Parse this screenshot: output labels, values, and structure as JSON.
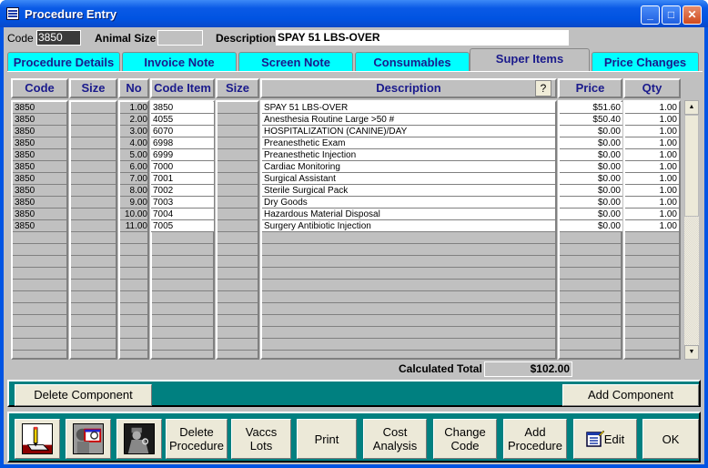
{
  "window": {
    "title": "Procedure Entry",
    "minimize": "_",
    "maximize": "□",
    "close": "✕"
  },
  "header": {
    "code_label": "Code",
    "code_value": "3850",
    "animal_size_label": "Animal Size",
    "animal_size_value": "",
    "description_label": "Description",
    "description_value": "SPAY 51 LBS-OVER"
  },
  "tabs": [
    {
      "label": "Procedure Details",
      "active": false
    },
    {
      "label": "Invoice Note",
      "active": false
    },
    {
      "label": "Screen Note",
      "active": false
    },
    {
      "label": "Consumables",
      "active": false
    },
    {
      "label": "Super Items",
      "active": true
    },
    {
      "label": "Price Changes",
      "active": false
    }
  ],
  "table": {
    "columns": [
      "Code",
      "Size",
      "No",
      "Code Item",
      "Size",
      "Description",
      "Price",
      "Qty"
    ],
    "help_button": "?",
    "rows": [
      {
        "code": "3850",
        "size": "",
        "no": "1.00",
        "code_item": "3850",
        "item_size": "",
        "description": "SPAY 51 LBS-OVER",
        "price": "$51.60",
        "qty": "1.00"
      },
      {
        "code": "3850",
        "size": "",
        "no": "2.00",
        "code_item": "4055",
        "item_size": "",
        "description": "Anesthesia Routine Large >50 #",
        "price": "$50.40",
        "qty": "1.00"
      },
      {
        "code": "3850",
        "size": "",
        "no": "3.00",
        "code_item": "6070",
        "item_size": "",
        "description": "HOSPITALIZATION (CANINE)/DAY",
        "price": "$0.00",
        "qty": "1.00"
      },
      {
        "code": "3850",
        "size": "",
        "no": "4.00",
        "code_item": "6998",
        "item_size": "",
        "description": "Preanesthetic Exam",
        "price": "$0.00",
        "qty": "1.00"
      },
      {
        "code": "3850",
        "size": "",
        "no": "5.00",
        "code_item": "6999",
        "item_size": "",
        "description": "Preanesthetic Injection",
        "price": "$0.00",
        "qty": "1.00"
      },
      {
        "code": "3850",
        "size": "",
        "no": "6.00",
        "code_item": "7000",
        "item_size": "",
        "description": "Cardiac Monitoring",
        "price": "$0.00",
        "qty": "1.00"
      },
      {
        "code": "3850",
        "size": "",
        "no": "7.00",
        "code_item": "7001",
        "item_size": "",
        "description": "Surgical Assistant",
        "price": "$0.00",
        "qty": "1.00"
      },
      {
        "code": "3850",
        "size": "",
        "no": "8.00",
        "code_item": "7002",
        "item_size": "",
        "description": "Sterile Surgical Pack",
        "price": "$0.00",
        "qty": "1.00"
      },
      {
        "code": "3850",
        "size": "",
        "no": "9.00",
        "code_item": "7003",
        "item_size": "",
        "description": "Dry Goods",
        "price": "$0.00",
        "qty": "1.00"
      },
      {
        "code": "3850",
        "size": "",
        "no": "10.00",
        "code_item": "7004",
        "item_size": "",
        "description": "Hazardous Material Disposal",
        "price": "$0.00",
        "qty": "1.00"
      },
      {
        "code": "3850",
        "size": "",
        "no": "11.00",
        "code_item": "7005",
        "item_size": "",
        "description": "Surgery Antibiotic Injection",
        "price": "$0.00",
        "qty": "1.00"
      }
    ]
  },
  "total": {
    "label": "Calculated Total",
    "value": "$102.00"
  },
  "component_bar": {
    "delete": "Delete Component",
    "add": "Add Component"
  },
  "toolbar": {
    "delete_procedure": "Delete\nProcedure",
    "vaccs_lots": "Vaccs\nLots",
    "print": "Print",
    "cost_analysis": "Cost\nAnalysis",
    "change_code": "Change\nCode",
    "add_procedure": "Add\nProcedure",
    "edit": "Edit",
    "ok": "OK"
  }
}
